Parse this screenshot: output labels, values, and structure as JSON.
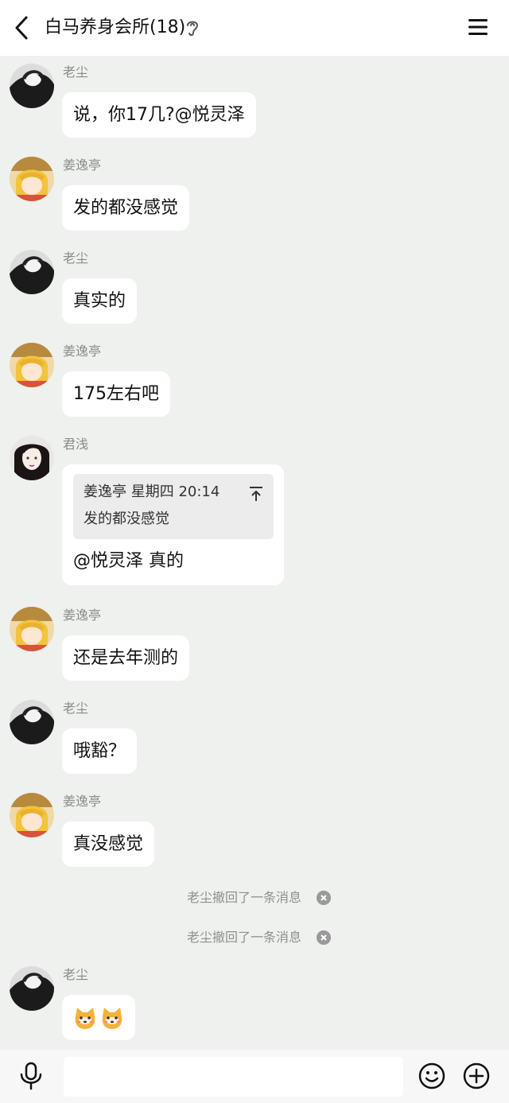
{
  "header": {
    "title": "白马养身会所(18)",
    "back_icon": "chevron-left-icon",
    "ear_icon": "ear-icon",
    "menu_icon": "hamburger-menu-icon"
  },
  "messages": [
    {
      "sender": "老尘",
      "text": "说，你17几?@悦灵泽",
      "avatar": "bw-manga-avatar"
    },
    {
      "sender": "姜逸亭",
      "text": "发的都没感觉",
      "avatar": "blonde-anime-avatar"
    },
    {
      "sender": "老尘",
      "text": "真实的",
      "avatar": "bw-manga-avatar"
    },
    {
      "sender": "姜逸亭",
      "text": "175左右吧",
      "avatar": "blonde-anime-avatar"
    },
    {
      "sender": "君浅",
      "avatar": "dark-hair-girl-avatar",
      "quote": {
        "header": "姜逸亭 星期四 20:14",
        "body": "发的都没感觉",
        "jump_icon": "jump-to-original-icon"
      },
      "text": "@悦灵泽 真的"
    },
    {
      "sender": "姜逸亭",
      "text": "还是去年测的",
      "avatar": "blonde-anime-avatar"
    },
    {
      "sender": "老尘",
      "text": "哦豁？",
      "avatar": "bw-manga-avatar"
    },
    {
      "sender": "姜逸亭",
      "text": "真没感觉",
      "avatar": "blonde-anime-avatar"
    },
    {
      "sender": "老尘",
      "text": "",
      "avatar": "bw-manga-avatar",
      "emoji": [
        "shiba-dog-emoji",
        "shiba-dog-emoji"
      ]
    }
  ],
  "system": [
    {
      "text": "老尘撤回了一条消息",
      "icon": "dismiss-x-icon"
    },
    {
      "text": "老尘撤回了一条消息",
      "icon": "dismiss-x-icon"
    }
  ],
  "input": {
    "placeholder": "",
    "voice_icon": "microphone-icon",
    "emoji_icon": "smiley-icon",
    "plus_icon": "plus-circle-icon"
  },
  "colors": {
    "chat_background": "#eef1ee",
    "bubble": "#ffffff",
    "sender_name": "#8a8a8a"
  }
}
